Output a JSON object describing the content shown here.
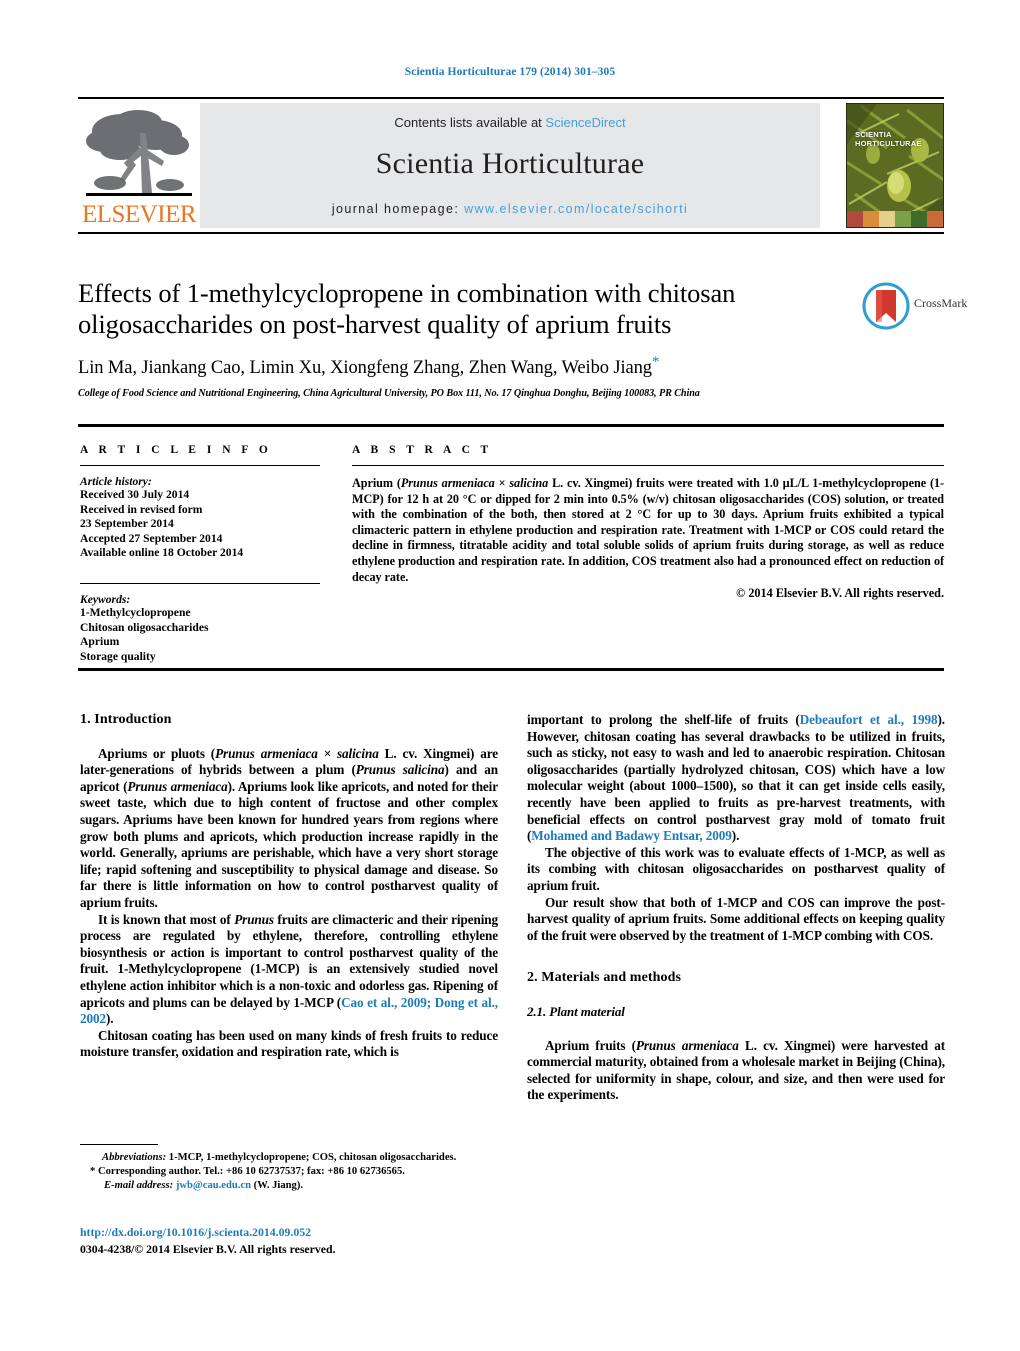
{
  "running_head": "Scientia Horticulturae 179 (2014) 301–305",
  "masthead": {
    "publisher_name": "ELSEVIER",
    "contents_prefix": "Contents lists available at ",
    "contents_link": "ScienceDirect",
    "journal_title": "Scientia Horticulturae",
    "homepage_prefix": "journal homepage: ",
    "homepage_url": "www.elsevier.com/locate/scihorti",
    "cover_label_line1": "SCIENTIA",
    "cover_label_line2": "HORTICULTURAE"
  },
  "crossmark": {
    "label": "CrossMark"
  },
  "article": {
    "title": "Effects of 1-methylcyclopropene in combination with chitosan oligosaccharides on post-harvest quality of aprium fruits",
    "authors": "Lin Ma, Jiankang Cao, Limin Xu, Xiongfeng Zhang, Zhen Wang, Weibo Jiang",
    "corresponding_marker": "*",
    "affiliation": "College of Food Science and Nutritional Engineering, China Agricultural University, PO Box 111, No. 17 Qinghua Donghu, Beijing 100083, PR China"
  },
  "article_info": {
    "heading": "A R T I C L E   I N F O",
    "history_label": "Article history:",
    "history": [
      "Received 30 July 2014",
      "Received in revised form",
      "23 September 2014",
      "Accepted 27 September 2014",
      "Available online 18 October 2014"
    ],
    "keywords_label": "Keywords:",
    "keywords": [
      "1-Methylcyclopropene",
      "Chitosan oligosaccharides",
      "Aprium",
      "Storage quality"
    ]
  },
  "abstract": {
    "heading": "A B S T R A C T",
    "p1_a": "Aprium (",
    "p1_italic1": "Prunus armeniaca",
    "p1_b": " × ",
    "p1_italic2": "salicina",
    "p1_c": " L. cv. Xingmei) fruits were treated with 1.0 µL/L 1-methylcyclopropene (1-MCP) for 12 h at 20 °C or dipped for 2 min into 0.5% (w/v) chitosan oligosaccharides (COS) solution, or treated with the combination of the both, then stored at 2 °C for up to 30 days. Aprium fruits exhibited a typical climacteric pattern in ethylene production and respiration rate. Treatment with 1-MCP or COS could retard the decline in firmness, titratable acidity and total soluble solids of aprium fruits during storage, as well as reduce ethylene production and respiration rate. In addition, COS treatment also had a pronounced effect on reduction of decay rate.",
    "copyright": "© 2014 Elsevier B.V. All rights reserved."
  },
  "body": {
    "intro_heading": "1.  Introduction",
    "intro_p1_a": "Apriums or pluots (",
    "intro_p1_i1": "Prunus armeniaca × salicina",
    "intro_p1_b": " L. cv. Xingmei) are later-generations of hybrids between a plum (",
    "intro_p1_i2": "Prunus salicina",
    "intro_p1_c": ") and an apricot (",
    "intro_p1_i3": "Prunus armeniaca",
    "intro_p1_d": "). Apriums look like apricots, and noted for their sweet taste, which due to high content of fructose and other complex sugars. Apriums have been known for hundred years from regions where grow both plums and apricots, which production increase rapidly in the world. Generally, apriums are perishable, which have a very short storage life; rapid softening and susceptibility to physical damage and disease. So far there is little information on how to control postharvest quality of aprium fruits.",
    "intro_p2_a": "It is known that most of ",
    "intro_p2_i1": "Prunus",
    "intro_p2_b": " fruits are climacteric and their ripening process are regulated by ethylene, therefore, controlling ethylene biosynthesis or action is important to control postharvest quality of the fruit. 1-Methylcyclopropene (1-MCP) is an extensively studied novel ethylene action inhibitor which is a non-toxic and odorless gas. Ripening of apricots and plums can be delayed by 1-MCP (",
    "intro_p2_ref": "Cao et al., 2009; Dong et al., 2002",
    "intro_p2_c": ").",
    "intro_p3": "Chitosan coating has been used on many kinds of fresh fruits to reduce moisture transfer, oxidation and respiration rate, which is",
    "right_p1_a": "important to prolong the shelf-life of fruits (",
    "right_p1_ref": "Debeaufort et al., 1998",
    "right_p1_b": "). However, chitosan coating has several drawbacks to be utilized in fruits, such as sticky, not easy to wash and led to anaerobic respiration. Chitosan oligosaccharides (partially hydrolyzed chitosan, COS) which have a low molecular weight (about 1000–1500), so that it can get inside cells easily, recently have been applied to fruits as pre-harvest treatments, with beneficial effects on control postharvest gray mold of tomato fruit (",
    "right_p1_ref2": "Mohamed and Badawy Entsar, 2009",
    "right_p1_c": ").",
    "right_p2": "The objective of this work was to evaluate effects of 1-MCP, as well as its combing with chitosan oligosaccharides on postharvest quality of aprium fruit.",
    "right_p3": "Our result show that both of 1-MCP and COS can improve the post-harvest quality of aprium fruits. Some additional effects on keeping quality of the fruit were observed by the treatment of 1-MCP combing with COS.",
    "methods_heading": "2.  Materials and methods",
    "plant_subheading": "2.1.  Plant material",
    "plant_p1_a": "Aprium fruits (",
    "plant_p1_i1": "Prunus armeniaca",
    "plant_p1_b": " L. cv. Xingmei) were harvested at commercial maturity, obtained from a wholesale market in Beijing (China), selected for uniformity in shape, colour, and size, and then were used for the experiments."
  },
  "footnotes": {
    "abbrev_label": "Abbreviations:",
    "abbrev_text": "  1-MCP, 1-methylcyclopropene; COS, chitosan oligosaccharides.",
    "corr_marker": "*",
    "corr_text": "  Corresponding author. Tel.: +86 10 62737537; fax: +86 10 62736565.",
    "email_label": "E-mail address:",
    "email": "jwb@cau.edu.cn",
    "email_suffix": " (W. Jiang).",
    "doi": "http://dx.doi.org/10.1016/j.scienta.2014.09.052",
    "issn": "0304-4238/© 2014 Elsevier B.V. All rights reserved."
  },
  "colors": {
    "link_blue": "#1c7bbd",
    "sciencedirect_blue": "#4a9fd5",
    "elsevier_orange": "#e87722",
    "band_grey": "#e6e7e8"
  }
}
